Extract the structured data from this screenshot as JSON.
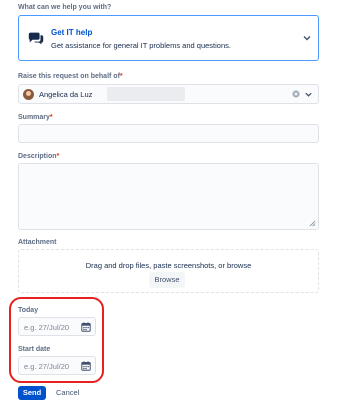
{
  "request_type": {
    "label": "What can we help you with?",
    "title": "Get IT help",
    "description": "Get assistance for general IT problems and questions.",
    "icon": "chat-bubbles-icon"
  },
  "on_behalf": {
    "label": "Raise this request on behalf of",
    "required_marker": "*",
    "value": "Angelica da Luz"
  },
  "summary": {
    "label": "Summary",
    "required_marker": "*",
    "value": ""
  },
  "description": {
    "label": "Description",
    "required_marker": "*",
    "value": ""
  },
  "attachment": {
    "label": "Attachment",
    "drop_text": "Drag and drop files, paste screenshots, or browse",
    "browse_label": "Browse"
  },
  "today": {
    "label": "Today",
    "placeholder": "e.g. 27/Jul/20"
  },
  "start_date": {
    "label": "Start date",
    "placeholder": "e.g. 27/Jul/20"
  },
  "actions": {
    "send_label": "Send",
    "cancel_label": "Cancel"
  },
  "colors": {
    "accent": "#0052cc",
    "focus_border": "#4c9aff",
    "highlight": "#e8201f",
    "required": "#de350b"
  }
}
